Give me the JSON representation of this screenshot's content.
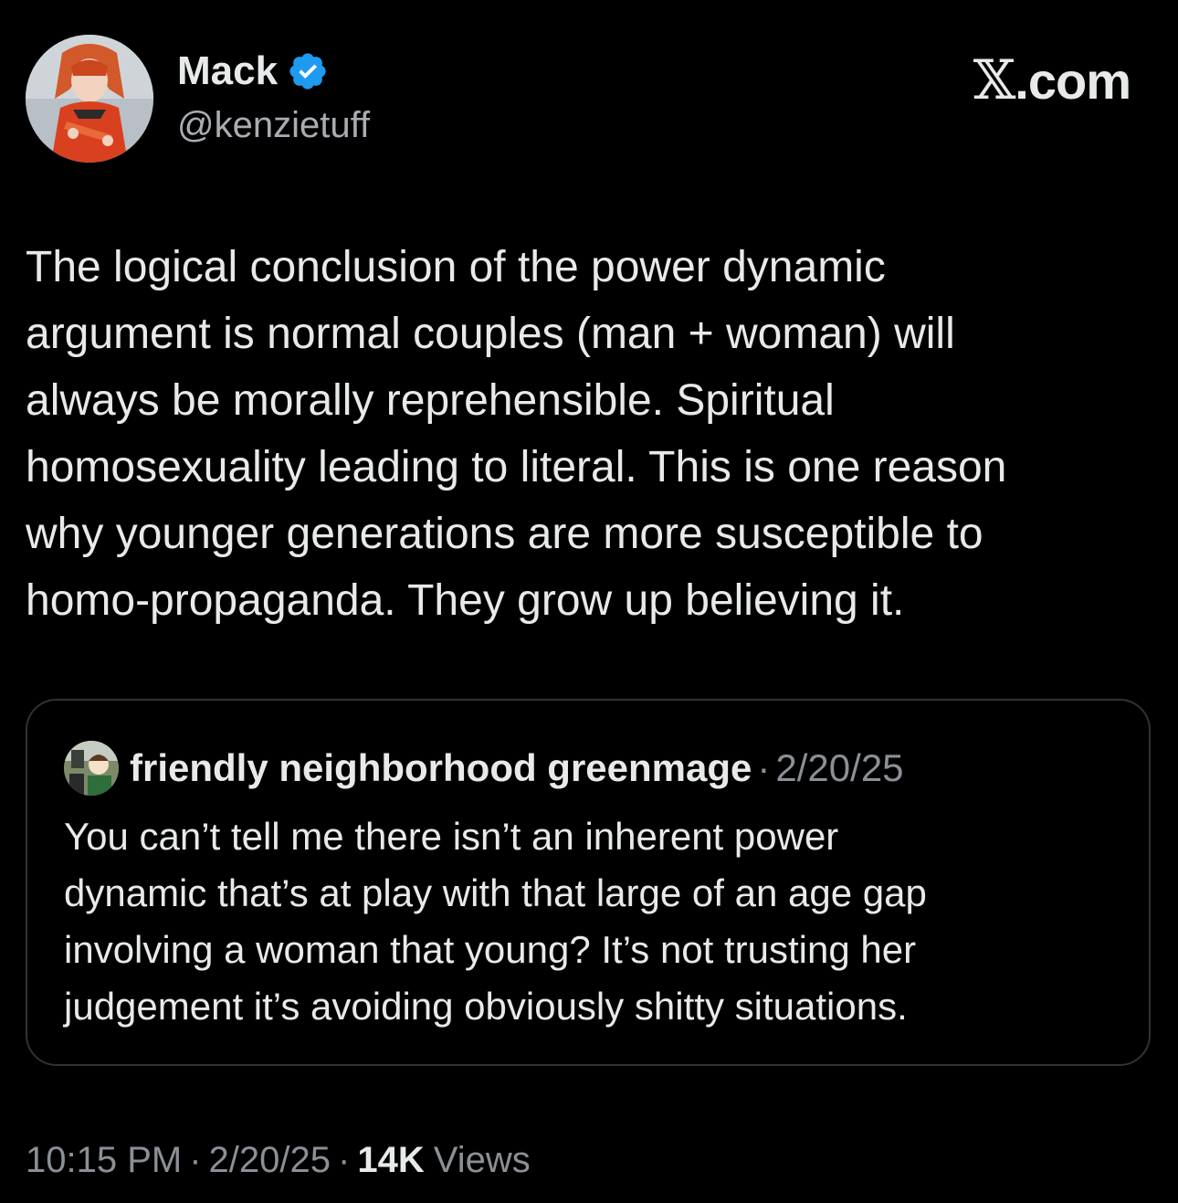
{
  "author": {
    "display_name": "Mack",
    "handle": "@kenzietuff",
    "verified": true
  },
  "brand": {
    "text": ".com",
    "x_glyph": "𝕏"
  },
  "tweet": {
    "text": "The logical conclusion of the power dynamic\nargument is normal couples (man + woman) will\nalways be morally reprehensible. Spiritual\nhomosexuality leading to literal. This is one reason\nwhy younger generations are more susceptible to\nhomo-propaganda. They grow up believing it."
  },
  "quoted_tweet": {
    "display_name": "friendly neighborhood greenmage",
    "separator": "·",
    "date": "2/20/25",
    "text": "You can’t tell me there isn’t an inherent power\ndynamic that’s at play with that large of an age gap\ninvolving a woman that young? It’s not trusting her\njudgement it’s avoiding obviously shitty situations."
  },
  "meta": {
    "time": "10:15 PM",
    "separator": "·",
    "date": "2/20/25",
    "views_count": "14K",
    "views_label": "Views"
  },
  "colors": {
    "background": "#000000",
    "text_primary": "#e7e9ea",
    "text_secondary": "#8b9096",
    "verified_blue": "#1d9bf0",
    "card_border": "#2f3336"
  },
  "icons": {
    "verified": "verified-badge-icon"
  }
}
